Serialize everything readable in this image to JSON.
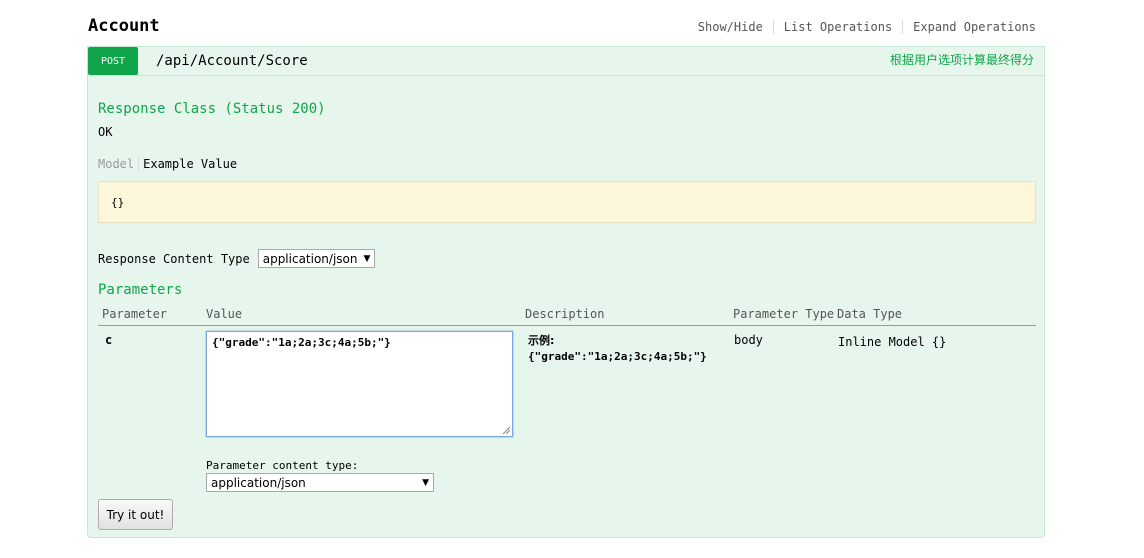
{
  "resource": {
    "title": "Account",
    "links": [
      {
        "label": "Show/Hide"
      },
      {
        "label": "List Operations"
      },
      {
        "label": "Expand Operations"
      }
    ]
  },
  "operation": {
    "method": "POST",
    "path": "/api/Account/Score",
    "summary": "根据用户选项计算最终得分",
    "response_class_title": "Response Class (Status 200)",
    "response_status_text": "OK",
    "tabs": {
      "model": "Model",
      "example": "Example Value"
    },
    "example_value": "{}",
    "response_content_type_label": "Response Content Type",
    "response_content_type_value": "application/json",
    "parameters_title": "Parameters",
    "param_headers": {
      "parameter": "Parameter",
      "value": "Value",
      "description": "Description",
      "parameter_type": "Parameter Type",
      "data_type": "Data Type"
    },
    "params": [
      {
        "name": "c",
        "value": "{\"grade\":\"1a;2a;3c;4a;5b;\"}",
        "description_label": "示例:",
        "description_value": "{\"grade\":\"1a;2a;3c;4a;5b;\"}",
        "parameter_type": "body",
        "data_type": "Inline Model {}"
      }
    ],
    "param_content_type_label": "Parameter content type:",
    "param_content_type_value": "application/json",
    "try_button_label": "Try it out!"
  },
  "colors": {
    "post_green": "#10a54a",
    "operation_bg": "#e7f6ec",
    "example_bg": "#fcf6db"
  }
}
